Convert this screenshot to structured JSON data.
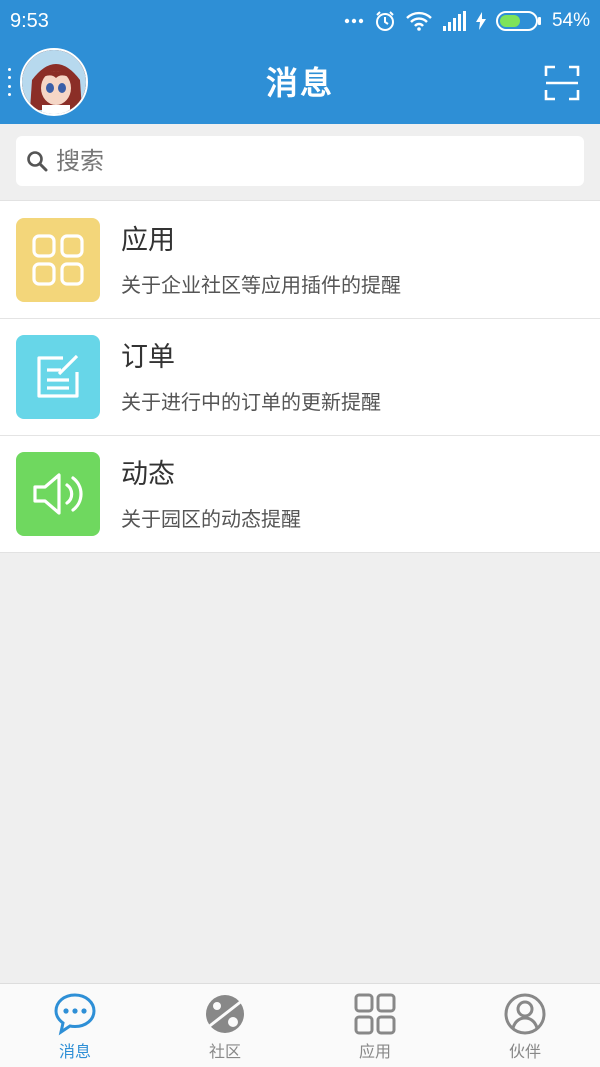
{
  "status_bar": {
    "time": "9:53",
    "battery": "54%",
    "icons": [
      "more-dots-icon",
      "alarm-icon",
      "wifi-icon",
      "signal-icon",
      "charging-icon",
      "battery-icon"
    ]
  },
  "header": {
    "title": "消息",
    "left": "avatar",
    "right_icon": "scan-icon"
  },
  "search": {
    "placeholder": "搜索"
  },
  "messages": [
    {
      "title": "应用",
      "desc": "关于企业社区等应用插件的提醒",
      "icon": "grid-icon",
      "color": "#f3d67a"
    },
    {
      "title": "订单",
      "desc": "关于进行中的订单的更新提醒",
      "icon": "edit-note-icon",
      "color": "#67d6e8"
    },
    {
      "title": "动态",
      "desc": "关于园区的动态提醒",
      "icon": "speaker-icon",
      "color": "#6fd85f"
    }
  ],
  "tabs": [
    {
      "label": "消息",
      "icon": "chat-bubble-icon",
      "active": true
    },
    {
      "label": "社区",
      "icon": "planet-icon",
      "active": false
    },
    {
      "label": "应用",
      "icon": "grid-icon",
      "active": false
    },
    {
      "label": "伙伴",
      "icon": "user-circle-icon",
      "active": false
    }
  ],
  "colors": {
    "primary": "#2e8fd6",
    "background": "#efefef",
    "inactive_tab": "#888888"
  }
}
